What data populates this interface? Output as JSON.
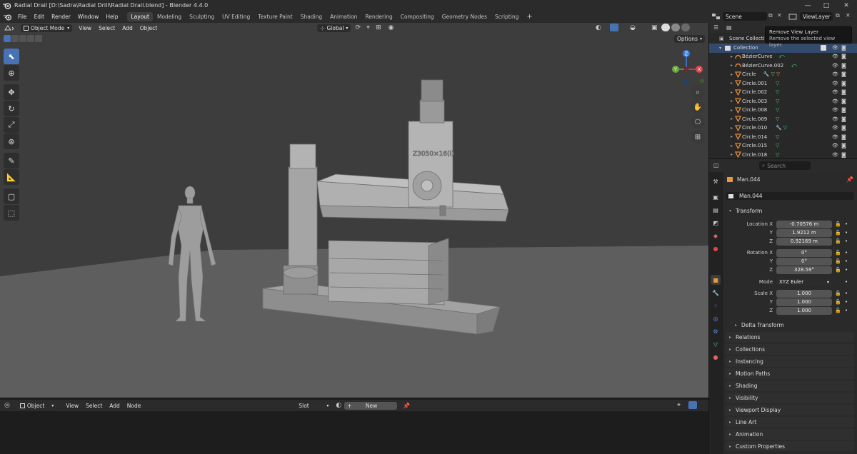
{
  "window": {
    "title": "Radial Drail [D:\\Sadra\\Radial Drill\\Radial Drail.blend] - Blender 4.4.0",
    "controls": {
      "minimize": "—",
      "maximize": "□",
      "close": "✕"
    }
  },
  "menu": [
    "File",
    "Edit",
    "Render",
    "Window",
    "Help"
  ],
  "workspaces": [
    {
      "label": "Layout",
      "active": true
    },
    {
      "label": "Modeling"
    },
    {
      "label": "Sculpting"
    },
    {
      "label": "UV Editing"
    },
    {
      "label": "Texture Paint"
    },
    {
      "label": "Shading"
    },
    {
      "label": "Animation"
    },
    {
      "label": "Rendering"
    },
    {
      "label": "Compositing"
    },
    {
      "label": "Geometry Nodes"
    },
    {
      "label": "Scripting"
    }
  ],
  "add_workspace": "+",
  "scene": {
    "name": "Scene",
    "view_layer": "ViewLayer"
  },
  "viewport": {
    "mode": "Object Mode",
    "menus": [
      "View",
      "Select",
      "Add",
      "Object"
    ],
    "orientation": "Global",
    "options_label": "Options",
    "gizmo": {
      "z": "Z",
      "x": "X",
      "y": "Y"
    },
    "scene_text": "Z3050×16(I)"
  },
  "shader_editor": {
    "type": "Object",
    "menus": [
      "View",
      "Select",
      "Add",
      "Node"
    ],
    "slot": "Slot",
    "new_label": "New",
    "plus": "+"
  },
  "outliner": {
    "root": "Scene Collection",
    "collection": "Collection",
    "items": [
      {
        "name": "BézierCurve",
        "type": "curve"
      },
      {
        "name": "BézierCurve.002",
        "type": "curve"
      },
      {
        "name": "Circle",
        "type": "mesh"
      },
      {
        "name": "Circle.001",
        "type": "mesh"
      },
      {
        "name": "Circle.002",
        "type": "mesh"
      },
      {
        "name": "Circle.003",
        "type": "mesh"
      },
      {
        "name": "Circle.008",
        "type": "mesh"
      },
      {
        "name": "Circle.009",
        "type": "mesh"
      },
      {
        "name": "Circle.010",
        "type": "mesh"
      },
      {
        "name": "Circle.014",
        "type": "mesh"
      },
      {
        "name": "Circle.015",
        "type": "mesh"
      },
      {
        "name": "Circle.018",
        "type": "mesh"
      }
    ]
  },
  "tooltip": {
    "title": "Remove View Layer",
    "description": "Remove the selected view layer."
  },
  "properties": {
    "search_placeholder": "Search",
    "object_name": "Man.044",
    "object_field": "Man.044",
    "transform_label": "Transform",
    "location": {
      "label": "Location X",
      "x": "-0.70576 m",
      "y": "1.9212 m",
      "z": "0.92169 m"
    },
    "rotation": {
      "label": "Rotation X",
      "x": "0°",
      "y": "0°",
      "z": "328.59°"
    },
    "mode_label": "Mode",
    "mode_value": "XYZ Euler",
    "scale": {
      "label": "Scale X",
      "x": "1.000",
      "y": "1.000",
      "z": "1.000"
    },
    "axis_y": "Y",
    "axis_z": "Z",
    "delta_transform": "Delta Transform",
    "panels": [
      "Relations",
      "Collections",
      "Instancing",
      "Motion Paths",
      "Shading",
      "Visibility",
      "Viewport Display",
      "Line Art",
      "Animation",
      "Custom Properties"
    ]
  },
  "colors": {
    "accent": "#4772b3",
    "viewport_bg": "#3d3d3d",
    "mesh_icon": "#e08a3a",
    "data_green": "#4dd17c",
    "axis_x": "#e2404a",
    "axis_y": "#6aa93c",
    "axis_z": "#3d80e0"
  }
}
